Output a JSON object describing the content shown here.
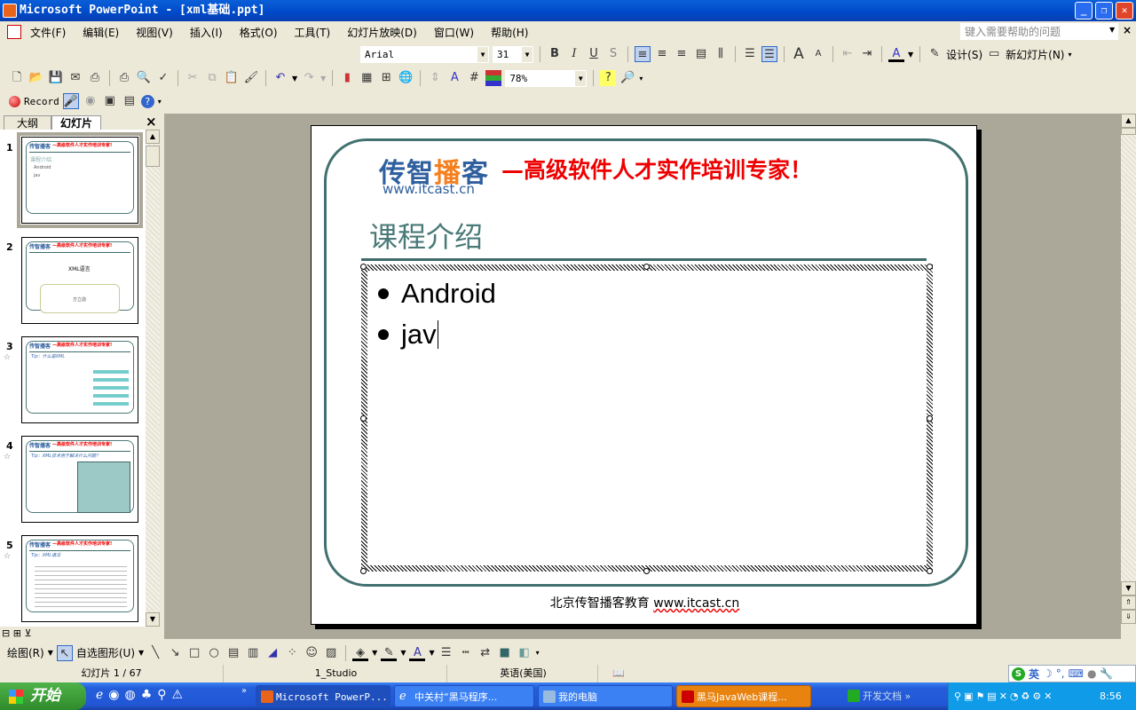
{
  "window": {
    "title": "Microsoft PowerPoint - [xml基础.ppt]"
  },
  "menu": [
    "文件(F)",
    "编辑(E)",
    "视图(V)",
    "插入(I)",
    "格式(O)",
    "工具(T)",
    "幻灯片放映(D)",
    "窗口(W)",
    "帮助(H)"
  ],
  "help_box": {
    "placeholder": "键入需要帮助的问题"
  },
  "formatting": {
    "font": "Arial",
    "size": "31",
    "design_label": "设计(S)",
    "new_slide_label": "新幻灯片(N)"
  },
  "standard": {
    "zoom": "78%"
  },
  "record_bar": {
    "record_label": "Record"
  },
  "left_pane": {
    "tabs": [
      "大纲",
      "幻灯片"
    ],
    "close": "×",
    "thumbnails": [
      {
        "num": "1",
        "lines": [
          "课程介绍",
          "Android",
          "jav"
        ]
      },
      {
        "num": "2",
        "lines": [
          "XML语言",
          "方立勋"
        ]
      },
      {
        "num": "3",
        "lines": [
          "Tip：什么是XML"
        ]
      },
      {
        "num": "4",
        "lines": [
          "Tip：XML技术用于解决什么问题？"
        ]
      },
      {
        "num": "5",
        "lines": [
          "Tip：XML语法"
        ]
      }
    ]
  },
  "slide": {
    "logo": "传智播客",
    "logo_url": "www.itcast.cn",
    "slogan": "—高级软件人才实作培训专家！",
    "title": "课程介绍",
    "bullets": [
      "Android",
      "jav"
    ],
    "footer_prefix": "北京传智播客教育 ",
    "footer_url": "www.itcast.cn"
  },
  "drawing": {
    "draw_label": "绘图(R)",
    "autoshape_label": "自选图形(U)"
  },
  "status": {
    "slide": "幻灯片 1 / 67",
    "design": "1_Studio",
    "language": "英语(美国)"
  },
  "ime": {
    "lang": "英"
  },
  "taskbar": {
    "start": "开始",
    "tasks": [
      "Microsoft PowerP...",
      "中关村“黑马程序...",
      "我的电脑",
      "黑马JavaWeb课程...",
      "开发文档"
    ],
    "clock": "8:56"
  },
  "colors": {
    "title_blue": "#0049c8",
    "slide_teal": "#42716f",
    "slogan_red": "#e00000",
    "workspace": "#aca899"
  }
}
